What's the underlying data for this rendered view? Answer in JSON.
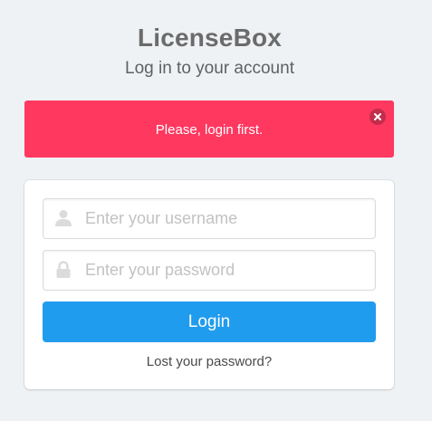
{
  "header": {
    "brand": "LicenseBox",
    "subtitle": "Log in to your account"
  },
  "alert": {
    "message": "Please, login first.",
    "color": "#ff3860",
    "close_icon": "close-icon"
  },
  "form": {
    "username": {
      "value": "",
      "placeholder": "Enter your username",
      "icon": "user-icon"
    },
    "password": {
      "value": "",
      "placeholder": "Enter your password",
      "icon": "lock-icon"
    },
    "login_label": "Login",
    "login_color": "#209cee",
    "lost_password_label": "Lost your password?"
  }
}
